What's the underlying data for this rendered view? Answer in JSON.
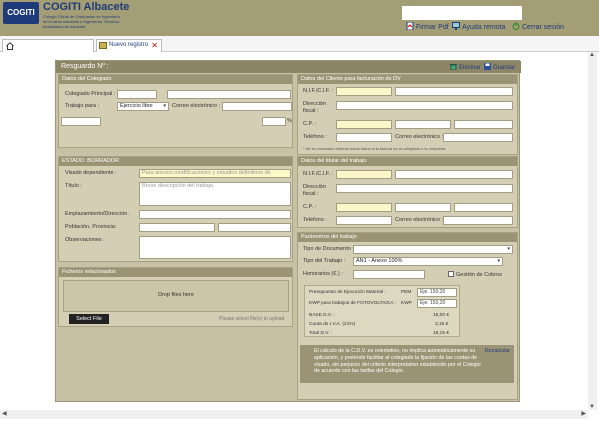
{
  "header": {
    "logo_mark": "COGITI",
    "logo_title": "COGITI Albacete",
    "logo_subtitle": "Colegio Oficial de Graduados en Ingeniería de la rama industrial e Ingenieros Técnicos Industriales de Albacete",
    "links": {
      "sign_pdf": "Firmar Pdf",
      "remote_help": "Ayuda remota",
      "logout": "Cerrar sesión"
    }
  },
  "tabs": {
    "active": "Nuevo registro"
  },
  "form": {
    "title": "Resguardo Nº :",
    "actions": {
      "delete": "Eliminar",
      "save": "Guardar"
    },
    "colegiado": {
      "title": "Datos del Colegiado",
      "colegiado_principal": "Colegiado Principal :",
      "trabajo_para": "Trabajo para :",
      "trabajo_para_value": "Ejercicio libre",
      "email": "Correo electrónico :",
      "pct": "%"
    },
    "estado": {
      "title": "ESTADO :BORRADOR",
      "visado_label": "Visado dependiente :",
      "visado_placeholder": "Para anexos,modificaciones y estudios definitivos de",
      "titulo_label": "Título :",
      "titulo_placeholder": "Breve descripción del trabajo.",
      "emplazamiento_label": "Emplazamiento/Dirección :",
      "poblacion_label": "Población, Provincia:",
      "observaciones_label": "Observaciones :"
    },
    "ficheros": {
      "title": "Ficheros relacionados",
      "drop": "Drop files here",
      "select_file": "Select File",
      "hint": "Please select file(s) to upload"
    },
    "cliente": {
      "title": "Datos del Cliente para facturación de DV",
      "nif": "N.I.F./C.I.F. :",
      "direccion": "Dirección fiscal :",
      "cp": "C.P. :",
      "telefono": "Teléfono :",
      "email": "Correo electrónico :",
      "note": "* No es necesario rellenar estos datos si la factura va al colegiado o su empresa"
    },
    "titular": {
      "title": "Datos del titular del trabajo",
      "nif": "N.I.F./C.I.F. :",
      "direccion": "Dirección fiscal :",
      "cp": "C.P. :",
      "telefono": "Teléfono :",
      "email": "Correo electrónico :"
    },
    "parametros": {
      "title": "Parámetros del trabajo",
      "tipo_documento": "Tipo de Documento :",
      "tipo_trabajo": "Tipo del Trabajo :",
      "tipo_trabajo_value": "AN1 - Anexo 100%",
      "honorarios": "Honorarios (€.) :",
      "gestion_cobros": "Gestión de Cobros",
      "calc": {
        "pem_label": "Presupuesto de Ejecución Material :",
        "pem_code": "PEM",
        "pem_value": "Eje. 150,20",
        "kwp_label": "KWP para trabajos de FOTOVOLTAICA :",
        "kwp_code": "KWP",
        "kwp_value": "Eje. 150,20",
        "base_label": "BASE D.V. :",
        "base_value": "15,00 €",
        "iva_label": "Cuota de I.V.A. (21%)",
        "iva_value": "3,15 €",
        "total_label": "Total D.V. :",
        "total_value": "18,15 €"
      },
      "info": "El cálculo de la C.D.V. es orientativo, no implica automáticamente su aplicación, y pretende facilitar al colegiado la fijación de las cuotas de visado, sin perjuicio del criterio interpretativo establecido por el Colegio de acuerdo con las tarifas del Colegio.",
      "recalcular": "Recalcular"
    }
  }
}
